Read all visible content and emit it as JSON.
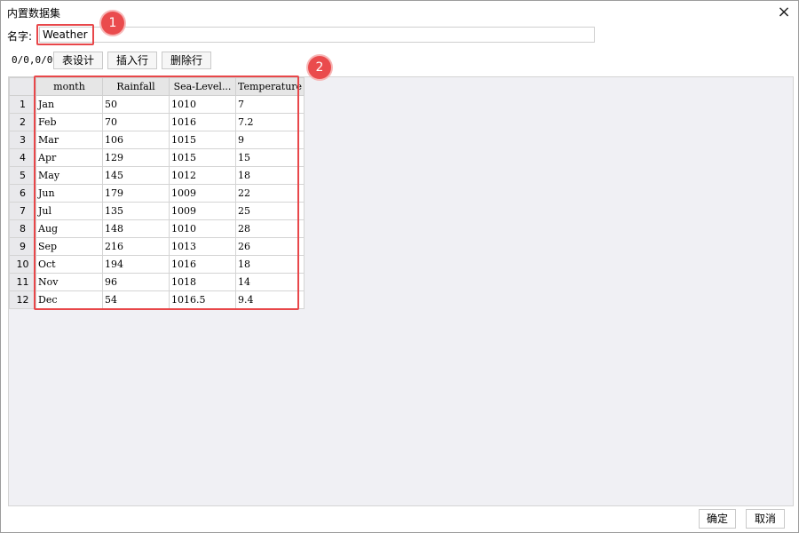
{
  "window": {
    "title": "内置数据集",
    "close_icon": "×"
  },
  "name_field": {
    "label": "名字:",
    "value": "Weather"
  },
  "toolbar": {
    "position": "0/0,0/0",
    "table_design": "表设计",
    "insert_row": "插入行",
    "delete_row": "删除行"
  },
  "annotations": {
    "badge1": "1",
    "badge2": "2",
    "color": "#e8474a"
  },
  "table": {
    "columns": [
      "month",
      "Rainfall",
      "Sea-Level...",
      "Temperature"
    ],
    "rows": [
      {
        "num": "1",
        "cells": [
          "Jan",
          "50",
          "1010",
          "7"
        ]
      },
      {
        "num": "2",
        "cells": [
          "Feb",
          "70",
          "1016",
          "7.2"
        ]
      },
      {
        "num": "3",
        "cells": [
          "Mar",
          "106",
          "1015",
          "9"
        ]
      },
      {
        "num": "4",
        "cells": [
          "Apr",
          "129",
          "1015",
          "15"
        ]
      },
      {
        "num": "5",
        "cells": [
          "May",
          "145",
          "1012",
          "18"
        ]
      },
      {
        "num": "6",
        "cells": [
          "Jun",
          "179",
          "1009",
          "22"
        ]
      },
      {
        "num": "7",
        "cells": [
          "Jul",
          "135",
          "1009",
          "25"
        ]
      },
      {
        "num": "8",
        "cells": [
          "Aug",
          "148",
          "1010",
          "28"
        ]
      },
      {
        "num": "9",
        "cells": [
          "Sep",
          "216",
          "1013",
          "26"
        ]
      },
      {
        "num": "10",
        "cells": [
          "Oct",
          "194",
          "1016",
          "18"
        ]
      },
      {
        "num": "11",
        "cells": [
          "Nov",
          "96",
          "1018",
          "14"
        ]
      },
      {
        "num": "12",
        "cells": [
          "Dec",
          "54",
          "1016.5",
          "9.4"
        ]
      }
    ]
  },
  "footer": {
    "ok": "确定",
    "cancel": "取消"
  }
}
